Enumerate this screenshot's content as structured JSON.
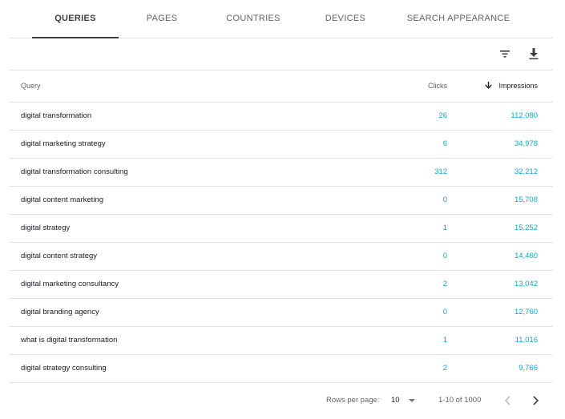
{
  "tabs": [
    {
      "label": "QUERIES",
      "active": true
    },
    {
      "label": "PAGES",
      "active": false
    },
    {
      "label": "COUNTRIES",
      "active": false
    },
    {
      "label": "DEVICES",
      "active": false
    },
    {
      "label": "SEARCH APPEARANCE",
      "active": false
    }
  ],
  "toolbar": {
    "filter_icon": "filter-icon",
    "download_icon": "download-icon"
  },
  "table": {
    "columns": {
      "query": "Query",
      "clicks": "Clicks",
      "impressions": "Impressions"
    },
    "sort": {
      "column": "impressions",
      "direction": "descending",
      "icon": "arrow-down-icon"
    },
    "rows": [
      {
        "query": "digital transformation",
        "clicks": "26",
        "impressions": "112,080"
      },
      {
        "query": "digital marketing strategy",
        "clicks": "6",
        "impressions": "34,978"
      },
      {
        "query": "digital transformation consulting",
        "clicks": "312",
        "impressions": "32,212"
      },
      {
        "query": "digital content marketing",
        "clicks": "0",
        "impressions": "15,708"
      },
      {
        "query": "digital strategy",
        "clicks": "1",
        "impressions": "15,252"
      },
      {
        "query": "digital content strategy",
        "clicks": "0",
        "impressions": "14,460"
      },
      {
        "query": "digital marketing consultancy",
        "clicks": "2",
        "impressions": "13,042"
      },
      {
        "query": "digital branding agency",
        "clicks": "0",
        "impressions": "12,760"
      },
      {
        "query": "what is digital transformation",
        "clicks": "1",
        "impressions": "11,016"
      },
      {
        "query": "digital strategy consulting",
        "clicks": "2",
        "impressions": "9,766"
      }
    ]
  },
  "pagination": {
    "rows_per_page_label": "Rows per page:",
    "rows_per_page_value": "10",
    "range": "1-10 of 1000",
    "prev_icon": "chevron-left-icon",
    "next_icon": "chevron-right-icon"
  },
  "colors": {
    "accent": "#12a4c7",
    "active_tab": "#3c4043",
    "divider": "#e0e0e0"
  }
}
